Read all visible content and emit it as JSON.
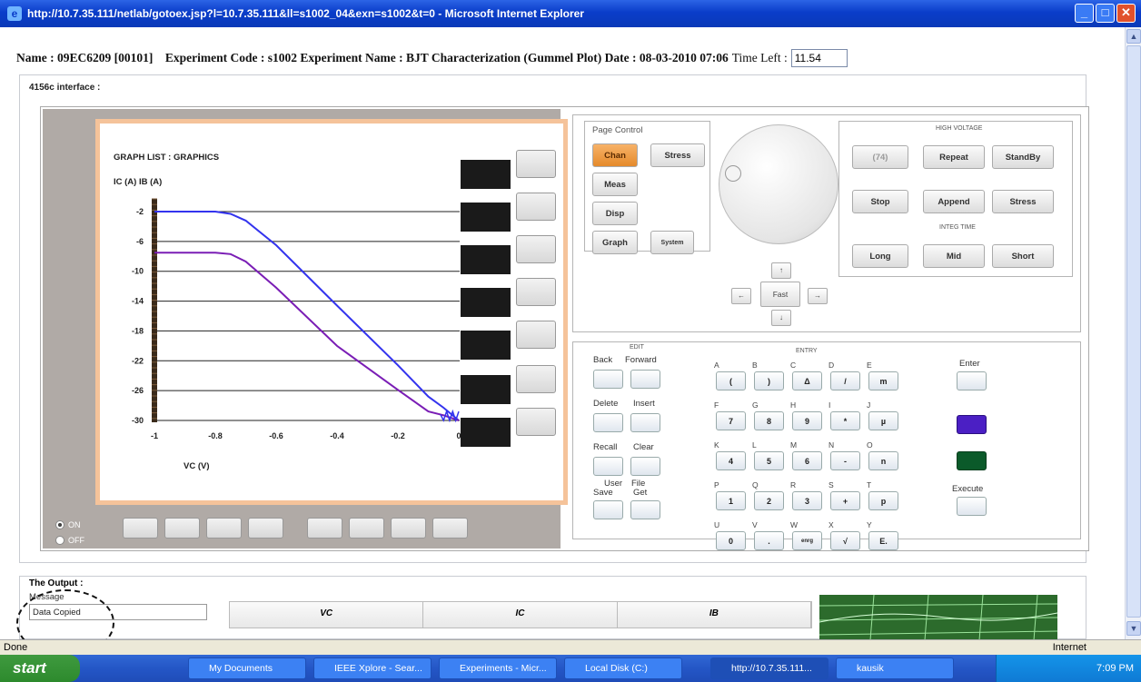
{
  "window": {
    "title": "http://10.7.35.111/netlab/gotoex.jsp?l=10.7.35.111&ll=s1002_04&exn=s1002&t=0 - Microsoft Internet Explorer"
  },
  "header": {
    "name_label": "Name :",
    "name": "09EC6209 [00101]",
    "exp_text": "Experiment Code : s1002 Experiment Name : BJT Characterization (Gummel Plot) Date : 08-03-2010 07:06",
    "time_label": "Time Left :",
    "time_value": "11.54"
  },
  "card": {
    "label": "4156c interface :"
  },
  "graph": {
    "list_title": "GRAPH LIST : GRAPHICS",
    "ylabels": "IC (A)  IB (A)",
    "xlabel": "VC (V)"
  },
  "chart_data": {
    "type": "line",
    "title": "GRAPH LIST : GRAPHICS",
    "xlabel": "VC (V)",
    "ylabel": "IC (A)  IB (A)",
    "xlim": [
      -1,
      0
    ],
    "ylim": [
      -30,
      -2
    ],
    "xticks": [
      "-1",
      "-0.8",
      "-0.6",
      "-0.4",
      "-0.2",
      "0"
    ],
    "yticks": [
      "-2",
      "-6",
      "-10",
      "-14",
      "-18",
      "-22",
      "-26",
      "-30"
    ],
    "series": [
      {
        "color": "#3333ee",
        "x": [
          -1,
          -0.8,
          -0.75,
          -0.7,
          -0.6,
          -0.4,
          -0.2,
          -0.1,
          -0.05,
          0
        ],
        "y": [
          -2,
          -2,
          -2.3,
          -3.2,
          -6.5,
          -14.6,
          -22.6,
          -26.8,
          -28.3,
          -30
        ]
      },
      {
        "color": "#7a1db5",
        "x": [
          -1,
          -0.8,
          -0.75,
          -0.7,
          -0.6,
          -0.4,
          -0.2,
          -0.1,
          -0.05,
          0
        ],
        "y": [
          -7.5,
          -7.5,
          -7.7,
          -8.7,
          -12.2,
          -20,
          -25.9,
          -28.8,
          -29.3,
          -30
        ]
      }
    ]
  },
  "radio": {
    "on": "ON",
    "off": "OFF"
  },
  "page_control": {
    "title": "Page Control",
    "chan": "Chan",
    "stress": "Stress",
    "meas": "Meas",
    "disp": "Disp",
    "graph": "Graph",
    "system": "System"
  },
  "arrows": {
    "up": "↑",
    "down": "↓",
    "left": "←",
    "right": "→",
    "fast": "Fast"
  },
  "hv": {
    "title": "HIGH VOLTAGE",
    "btn74": "(74)",
    "repeat": "Repeat",
    "standby": "StandBy",
    "stop": "Stop",
    "append": "Append",
    "stress": "Stress",
    "integ": "INTEG TIME",
    "long": "Long",
    "mid": "Mid",
    "short": "Short"
  },
  "edit": {
    "edit_title": "EDIT",
    "entry_title": "ENTRY",
    "back": "Back",
    "forward": "Forward",
    "delete": "Delete",
    "insert": "Insert",
    "recall": "Recall",
    "clear": "Clear",
    "user": "User",
    "file": "File",
    "save": "Save",
    "get": "Get",
    "enter": "Enter",
    "execute": "Execute"
  },
  "keys": {
    "l1": [
      "A",
      "B",
      "C",
      "D",
      "E"
    ],
    "k1": [
      "(",
      ")",
      "Δ",
      "/",
      "m"
    ],
    "l2": [
      "F",
      "G",
      "H",
      "I",
      "J"
    ],
    "k2": [
      "7",
      "8",
      "9",
      "*",
      "µ"
    ],
    "l3": [
      "K",
      "L",
      "M",
      "N",
      "O"
    ],
    "k3": [
      "4",
      "5",
      "6",
      "-",
      "n"
    ],
    "l4": [
      "P",
      "Q",
      "R",
      "S",
      "T"
    ],
    "k4": [
      "1",
      "2",
      "3",
      "+",
      "p"
    ],
    "l5": [
      "U",
      "V",
      "W",
      "X",
      "Y"
    ],
    "k5": [
      "0",
      ".",
      "enrg",
      "√",
      "E."
    ]
  },
  "output": {
    "title": "The Output :",
    "message_label": "Message",
    "message": "Data Copied",
    "cols": [
      "VC",
      "IC",
      "IB"
    ]
  },
  "status": {
    "left": "Done",
    "zone": "Internet"
  },
  "taskbar": {
    "start": "start",
    "tasks": [
      "My Documents",
      "IEEE Xplore - Sear...",
      "Experiments - Micr...",
      "Local Disk (C:)",
      "http://10.7.35.111...",
      "kausik"
    ],
    "clock": "7:09 PM"
  }
}
